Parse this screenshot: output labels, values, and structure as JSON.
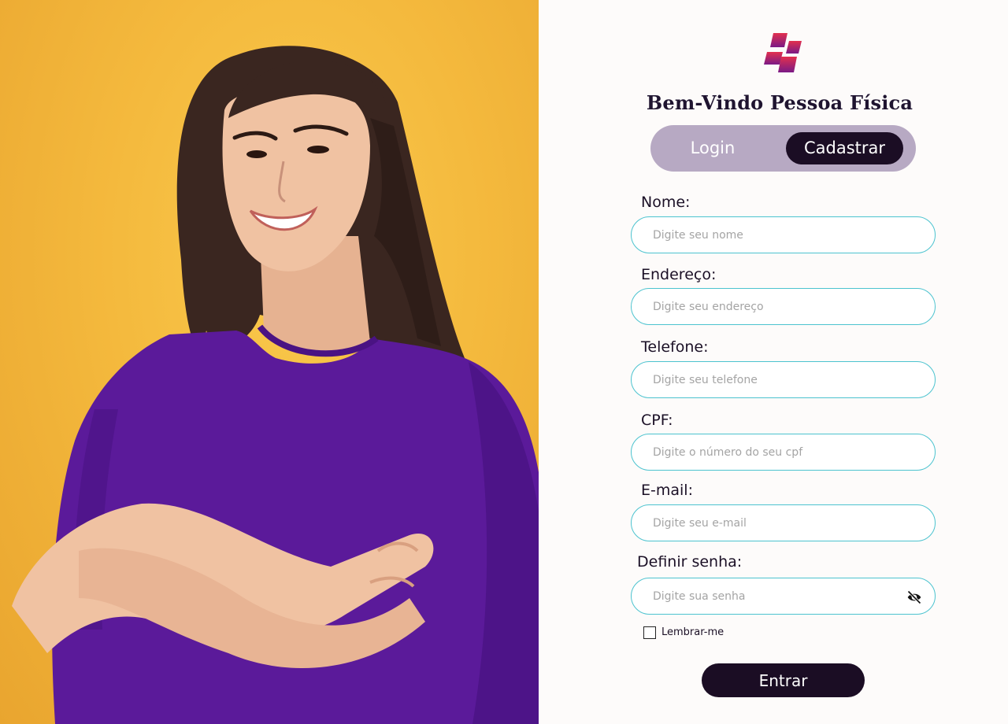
{
  "hero_image": {
    "description_icon": "smiling-woman-photo"
  },
  "brand": {
    "logo_icon": "stacked-parallelograms-logo",
    "colors": [
      "#e2304e",
      "#7b1a86"
    ]
  },
  "header": {
    "title": "Bem-Vindo Pessoa Física"
  },
  "tabs": [
    {
      "label": "Login",
      "active": false
    },
    {
      "label": "Cadastrar",
      "active": true
    }
  ],
  "form": {
    "fields": [
      {
        "label": "Nome:",
        "placeholder": "Digite seu nome",
        "value": ""
      },
      {
        "label": "Endereço:",
        "placeholder": "Digite seu endereço",
        "value": ""
      },
      {
        "label": "Telefone:",
        "placeholder": "Digite seu telefone",
        "value": ""
      },
      {
        "label": "CPF:",
        "placeholder": "Digite o número do seu cpf",
        "value": ""
      },
      {
        "label": "E-mail:",
        "placeholder": "Digite seu e-mail",
        "value": ""
      },
      {
        "label": "Definir senha:",
        "placeholder": "Digite sua senha",
        "value": ""
      }
    ],
    "password_toggle_icon": "eye-slash-icon",
    "remember_label": "Lembrar-me",
    "remember_checked": false,
    "submit_label": "Entrar"
  },
  "colors": {
    "accent_dark": "#1b0d24",
    "tab_track": "#b7a9c3",
    "input_border": "#4cc3cf",
    "photo_background": "#f4b93d",
    "shirt": "#5b1a9a"
  }
}
